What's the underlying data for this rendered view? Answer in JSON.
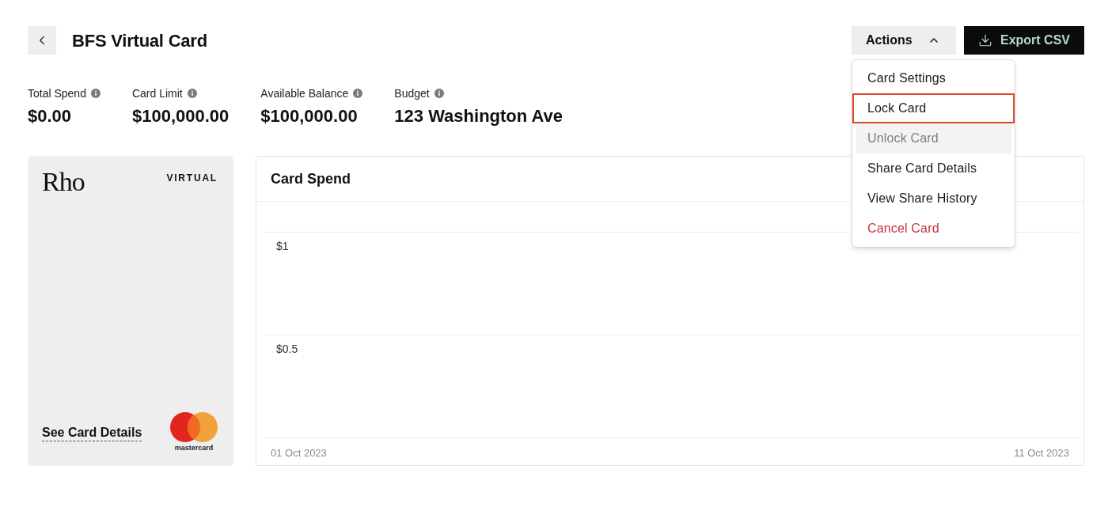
{
  "header": {
    "title": "BFS Virtual Card",
    "actions_button": {
      "label": "Actions",
      "expanded": true
    },
    "export_button": {
      "label": "Export CSV"
    }
  },
  "actions_menu": {
    "items": [
      {
        "label": "Card Settings",
        "kind": "default",
        "disabled": false,
        "focused": false
      },
      {
        "label": "Lock Card",
        "kind": "default",
        "disabled": false,
        "focused": true
      },
      {
        "label": "Unlock Card",
        "kind": "default",
        "disabled": true,
        "focused": false
      },
      {
        "label": "Share Card Details",
        "kind": "default",
        "disabled": false,
        "focused": false
      },
      {
        "label": "View Share History",
        "kind": "default",
        "disabled": false,
        "focused": false
      },
      {
        "label": "Cancel Card",
        "kind": "danger",
        "disabled": false,
        "focused": false
      }
    ]
  },
  "stats": [
    {
      "label": "Total Spend",
      "value": "$0.00"
    },
    {
      "label": "Card Limit",
      "value": "$100,000.00"
    },
    {
      "label": "Available Balance",
      "value": "$100,000.00"
    },
    {
      "label": "Budget",
      "value": "123 Washington Ave"
    }
  ],
  "card": {
    "logo": "Rho",
    "type": "VIRTUAL",
    "details_link": "See Card Details",
    "network": "mastercard"
  },
  "chart": {
    "title": "Card Spend",
    "y_axis_labels": [
      "$1",
      "$0.5"
    ],
    "x_axis_labels": [
      "01 Oct 2023",
      "11 Oct 2023"
    ]
  }
}
